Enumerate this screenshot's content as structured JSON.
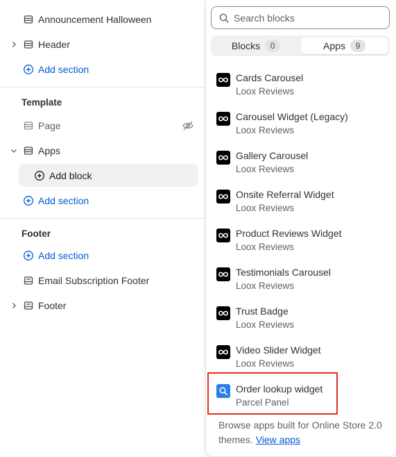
{
  "sidebar": {
    "rows": [
      {
        "label": "Announcement Halloween"
      },
      {
        "label": "Header"
      },
      {
        "label": "Add section"
      }
    ],
    "template": {
      "title": "Template",
      "page_label": "Page",
      "apps_label": "Apps",
      "add_block_label": "Add block",
      "add_section_label": "Add section"
    },
    "footer": {
      "title": "Footer",
      "add_section_label": "Add section",
      "email_label": "Email Subscription Footer",
      "footer_label": "Footer"
    }
  },
  "popover": {
    "search_placeholder": "Search blocks",
    "tabs": [
      {
        "label": "Blocks",
        "count": "0"
      },
      {
        "label": "Apps",
        "count": "9"
      }
    ],
    "apps": [
      {
        "name": "Cards Carousel",
        "vendor": "Loox Reviews",
        "icon": "loox-infinity-icon"
      },
      {
        "name": "Carousel Widget (Legacy)",
        "vendor": "Loox Reviews",
        "icon": "loox-infinity-icon"
      },
      {
        "name": "Gallery Carousel",
        "vendor": "Loox Reviews",
        "icon": "loox-infinity-icon"
      },
      {
        "name": "Onsite Referral Widget",
        "vendor": "Loox Reviews",
        "icon": "loox-infinity-icon"
      },
      {
        "name": "Product Reviews Widget",
        "vendor": "Loox Reviews",
        "icon": "loox-infinity-icon"
      },
      {
        "name": "Testimonials Carousel",
        "vendor": "Loox Reviews",
        "icon": "loox-infinity-icon"
      },
      {
        "name": "Trust Badge",
        "vendor": "Loox Reviews",
        "icon": "loox-infinity-icon"
      },
      {
        "name": "Video Slider Widget",
        "vendor": "Loox Reviews",
        "icon": "loox-infinity-icon"
      },
      {
        "name": "Order lookup widget",
        "vendor": "Parcel Panel",
        "icon": "parcel-search-icon"
      }
    ],
    "footer_text": "Browse apps built for Online Store 2.0 themes.",
    "footer_link": "View apps"
  },
  "colors": {
    "link": "#005bd3",
    "highlight": "#e0301e",
    "loox": "#000000",
    "parcel": "#2b7de9"
  }
}
